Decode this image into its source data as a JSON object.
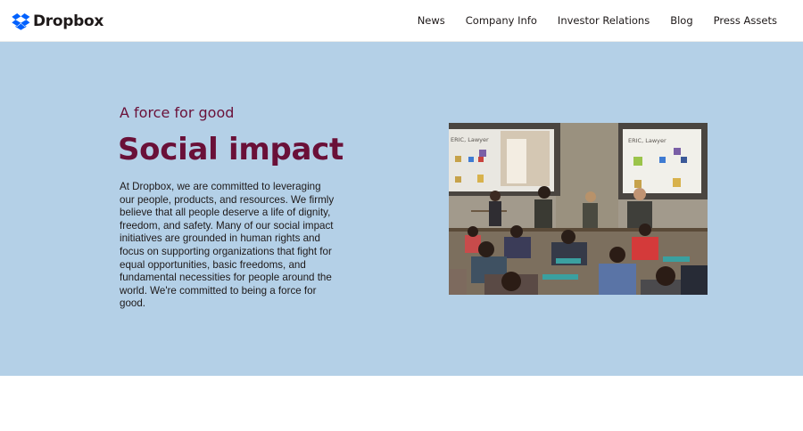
{
  "brand": {
    "name": "Dropbox",
    "logo_icon": "dropbox-box-icon",
    "logo_color": "#0061fe"
  },
  "nav": {
    "items": [
      {
        "label": "News"
      },
      {
        "label": "Company Info"
      },
      {
        "label": "Investor Relations"
      },
      {
        "label": "Blog"
      },
      {
        "label": "Press Assets"
      }
    ]
  },
  "hero": {
    "eyebrow": "A force for good",
    "title": "Social impact",
    "body": "At Dropbox, we are committed to leveraging our people, products, and resources. We firmly believe that all people deserve a life of dignity, freedom, and safety. Many of our social impact initiatives are grounded in human rights and focus on supporting organizations that fight for equal opportunities, basic freedoms, and fundamental necessities for people around the world. We're committed to being a force for good.",
    "background_color": "#b4d0e7",
    "accent_color": "#6a1038",
    "photo": {
      "slide_left_caption": "ERIC, Lawyer",
      "slide_right_caption": "ERIC, Lawyer"
    }
  }
}
